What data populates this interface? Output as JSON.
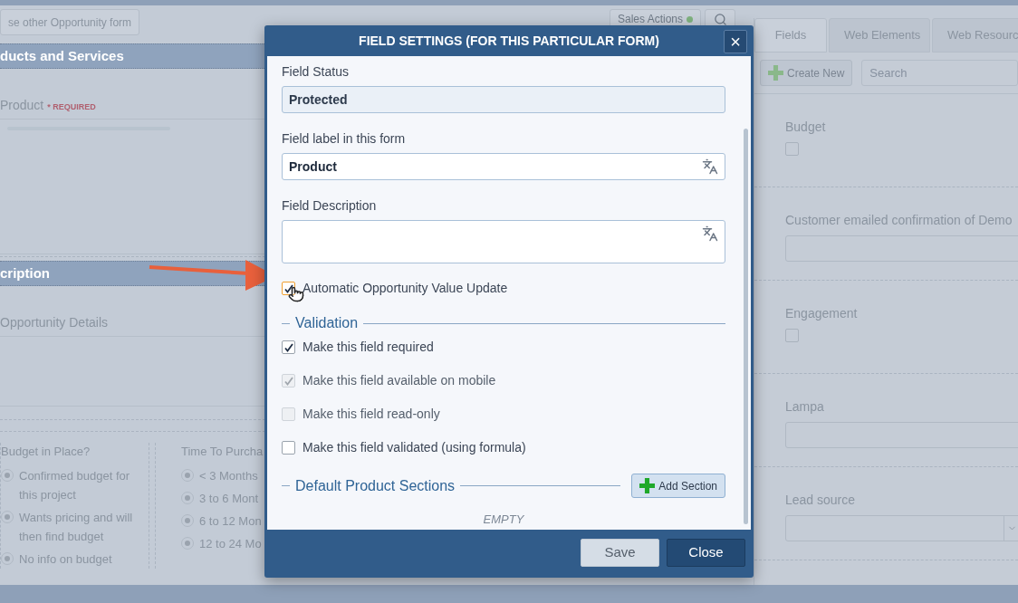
{
  "toolbar": {
    "form_button": "se other Opportunity form",
    "actions_button": "Sales Actions"
  },
  "form": {
    "sections": [
      {
        "title": "ducts and Services",
        "field_label": "Product",
        "required": "* REQUIRED",
        "kind": "product"
      },
      {
        "title": "cription",
        "field_label": "Opportunity Details",
        "kind": "textarea"
      }
    ],
    "groups": [
      {
        "title": "Budget in Place?",
        "options": [
          {
            "label": "Confirmed budget for this project",
            "selected": false
          },
          {
            "label": "Wants pricing and will then find budget",
            "selected": false
          },
          {
            "label": "No info on budget",
            "selected": false
          }
        ]
      },
      {
        "title": "Time To Purcha",
        "options": [
          {
            "label": "< 3 Months",
            "selected": false
          },
          {
            "label": "3 to 6 Mont",
            "selected": false
          },
          {
            "label": "6 to 12 Mon",
            "selected": false
          },
          {
            "label": "12 to 24 Mo",
            "selected": false
          }
        ]
      }
    ]
  },
  "side_panel": {
    "tabs": [
      {
        "label": "Fields",
        "selected": true
      },
      {
        "label": "Web Elements",
        "selected": false
      },
      {
        "label": "Web Resourc",
        "selected": false
      }
    ],
    "create_button": "Create New",
    "search": {
      "placeholder": "Search"
    },
    "fields": [
      {
        "label": "Budget",
        "kind": "checkbox",
        "checked": false
      },
      {
        "label": "Customer emailed confirmation of Demo",
        "kind": "text"
      },
      {
        "label": "Engagement",
        "kind": "checkbox",
        "checked": false
      },
      {
        "label": "Lampa",
        "kind": "text"
      },
      {
        "label": "Lead source",
        "kind": "select"
      }
    ]
  },
  "modal": {
    "title": "FIELD SETTINGS (FOR THIS PARTICULAR FORM)",
    "close_icon": "×",
    "status": {
      "label": "Field Status",
      "value": "Protected"
    },
    "label_field": {
      "label": "Field label in this form",
      "value": "Product"
    },
    "description": {
      "label": "Field Description"
    },
    "auto_update": {
      "label": "Automatic Opportunity Value Update",
      "checked": true,
      "focused": true
    },
    "validation": {
      "title": "Validation",
      "options": [
        {
          "label": "Make this field required",
          "checked": true,
          "disabled": false
        },
        {
          "label": "Make this field available on mobile",
          "checked": true,
          "disabled": true
        },
        {
          "label": "Make this field read-only",
          "checked": false,
          "disabled": true
        },
        {
          "label": "Make this field validated (using formula)",
          "checked": false,
          "disabled": false
        }
      ]
    },
    "sections": {
      "title": "Default Product Sections",
      "add_button": "Add Section",
      "empty": "EMPTY"
    },
    "buttons": [
      "Save",
      "Close"
    ]
  }
}
